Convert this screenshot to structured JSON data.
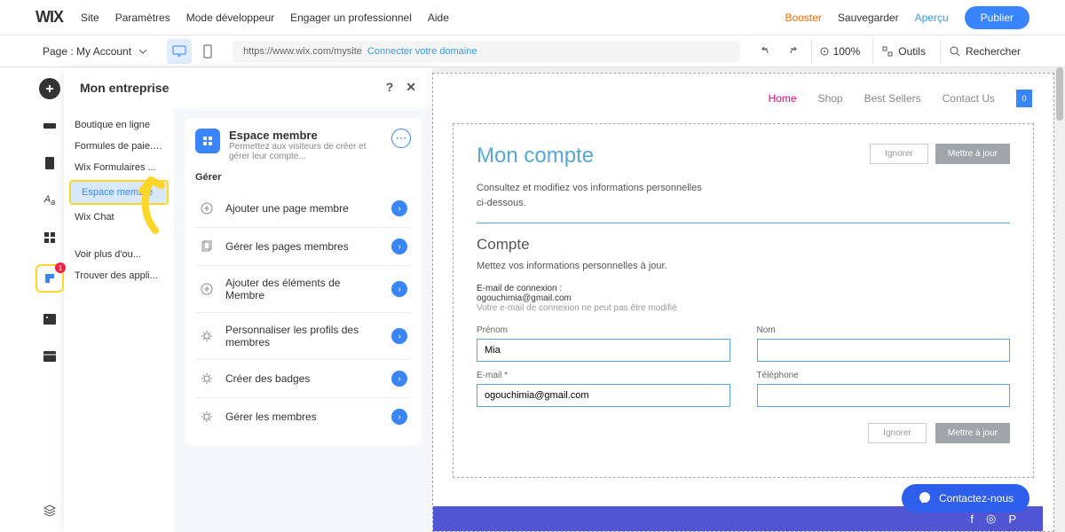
{
  "topbar": {
    "logo": "WIX",
    "menu": [
      "Site",
      "Paramètres",
      "Mode développeur",
      "Engager un professionnel",
      "Aide"
    ],
    "booster": "Booster",
    "save": "Sauvegarder",
    "preview": "Aperçu",
    "publish": "Publier"
  },
  "secondbar": {
    "page_label": "Page : My Account",
    "url": "https://www.wix.com/mysite",
    "connect_domain": "Connecter votre domaine",
    "zoom": "100%",
    "tools": "Outils",
    "search": "Rechercher"
  },
  "panel": {
    "title": "Mon entreprise",
    "sidebar": [
      {
        "label": "Boutique en ligne",
        "dot": false
      },
      {
        "label": "Formules de paie...",
        "dot": true
      },
      {
        "label": "Wix Formulaires ...",
        "dot": false
      },
      {
        "label": "Espace membre",
        "dot": false,
        "highlighted": true
      },
      {
        "label": "Wix Chat",
        "dot": false
      },
      {
        "label": "Voir plus d'ou...",
        "dot": false,
        "spacer": true
      },
      {
        "label": "Trouver des appli...",
        "dot": false
      }
    ],
    "card": {
      "title": "Espace membre",
      "subtitle": "Permettez aux visiteurs de créer et gérer leur compte..."
    },
    "section_label": "Gérer",
    "actions": [
      "Ajouter une page membre",
      "Gérer les pages membres",
      "Ajouter des éléments de Membre",
      "Personnaliser les profils des membres",
      "Créer des badges",
      "Gérer les membres"
    ]
  },
  "site": {
    "nav": [
      "Home",
      "Shop",
      "Best Sellers",
      "Contact Us"
    ],
    "bag_count": "0",
    "account_title": "Mon compte",
    "account_sub": "Consultez et modifiez vos informations personnelles ci-dessous.",
    "btn_ignore": "Ignorer",
    "btn_update": "Mettre à jour",
    "section_title": "Compte",
    "section_sub": "Mettez vos informations personnelles à jour.",
    "email_label": "E-mail de connexion :",
    "email_value": "ogouchimia@gmail.com",
    "email_note": "Votre e-mail de connexion ne peut pas être modifié",
    "fields": {
      "prenom_label": "Prénom",
      "prenom_value": "Mia",
      "nom_label": "Nom",
      "nom_value": "",
      "email_field_label": "E-mail *",
      "email_field_value": "ogouchimia@gmail.com",
      "tel_label": "Téléphone",
      "tel_value": ""
    }
  },
  "chat": {
    "label": "Contactez-nous"
  },
  "leftbar_badge": "1"
}
